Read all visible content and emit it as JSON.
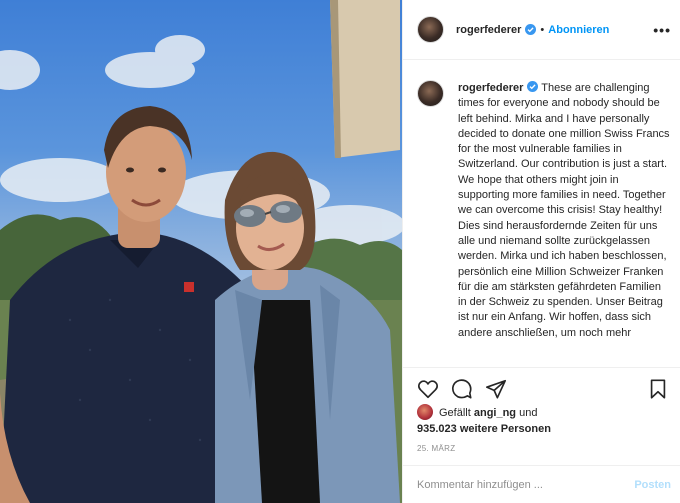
{
  "header": {
    "username": "rogerfederer",
    "separator": "•",
    "follow_label": "Abonnieren",
    "more_label": "•••"
  },
  "caption": {
    "username": "rogerfederer",
    "text": "These are challenging times for everyone and nobody should be left behind. Mirka and I have personally decided to donate one million Swiss Francs for the most vulnerable families in Switzerland. Our contribution is just a start. We hope that others might join in supporting more families in need. Together we can overcome this crisis! Stay healthy! Dies sind herausfordernde Zeiten für uns alle und niemand sollte zurückgelassen werden. Mirka und ich haben beschlossen, persönlich eine Million Schweizer Franken für die am stärksten gefährdeten Familien in der Schweiz zu spenden. Unser Beitrag ist nur ein Anfang. Wir hoffen, dass sich andere anschließen, um noch mehr"
  },
  "actions": {
    "icons": [
      "heart-icon",
      "comment-icon",
      "share-icon",
      "bookmark-icon"
    ]
  },
  "likes": {
    "prefix": "Gefällt",
    "liker": "angi_ng",
    "and": "und",
    "count": "935.023 weitere Personen"
  },
  "date": "25. MÄRZ",
  "comment": {
    "placeholder": "Kommentar hinzufügen ...",
    "post_label": "Posten"
  },
  "colors": {
    "accent": "#0095f6",
    "post_disabled": "#b2dffc",
    "verified": "#3897f0"
  }
}
